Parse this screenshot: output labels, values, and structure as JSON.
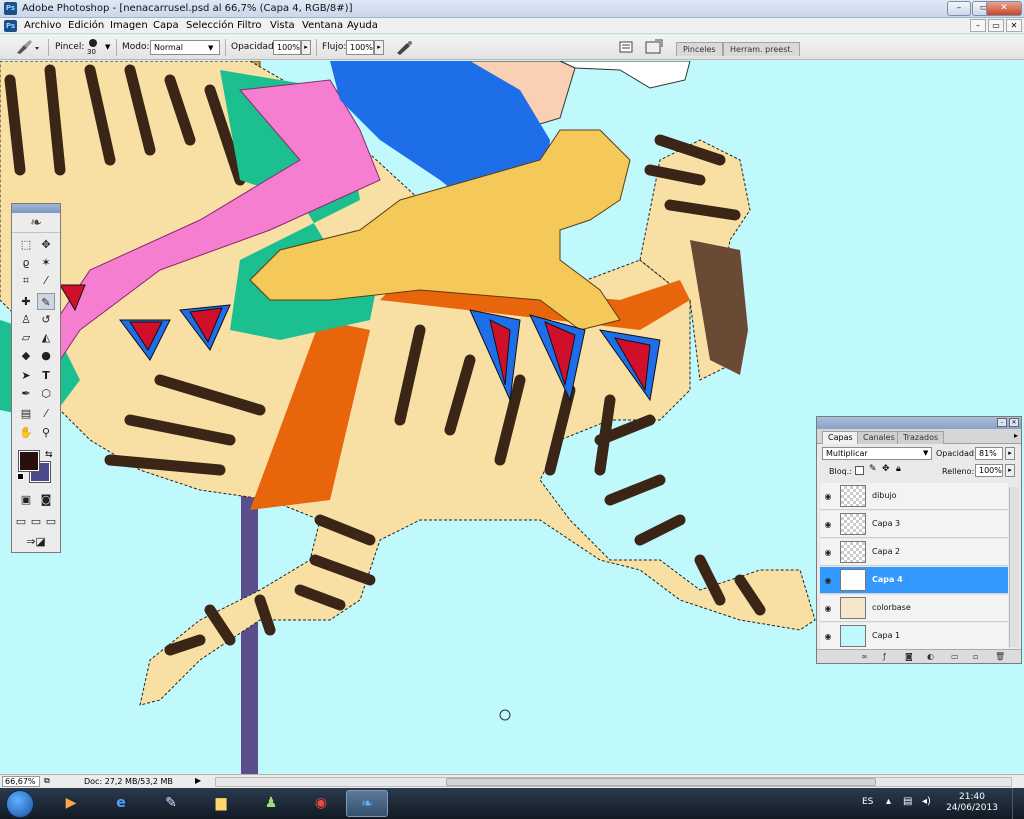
{
  "window": {
    "title": "Adobe Photoshop - [nenacarrusel.psd al 66,7% (Capa 4, RGB/8#)]",
    "buttons": [
      "–",
      "▭",
      "✕"
    ],
    "app_icon_text": "Ps"
  },
  "menubar": {
    "items": [
      "Archivo",
      "Edición",
      "Imagen",
      "Capa",
      "Selección",
      "Filtro",
      "Vista",
      "Ventana",
      "Ayuda"
    ],
    "doc_buttons": [
      "–",
      "▭",
      "✕"
    ]
  },
  "options": {
    "brush_label": "Pincel:",
    "brush_size": "30",
    "mode_label": "Modo:",
    "mode_value": "Normal",
    "opacity_label": "Opacidad:",
    "opacity_value": "100%",
    "flow_label": "Flujo:",
    "flow_value": "100%",
    "palette_tabs": [
      "Pinceles",
      "Herram. preest."
    ]
  },
  "layers_panel": {
    "tabs": [
      "Capas",
      "Canales",
      "Trazados"
    ],
    "blend_mode": "Multiplicar",
    "opacity_label": "Opacidad:",
    "opacity_value": "81%",
    "lock_label": "Bloq.:",
    "fill_label": "Relleno:",
    "fill_value": "100%",
    "layers": [
      {
        "name": "dibujo",
        "selected": false
      },
      {
        "name": "Capa 3",
        "selected": false
      },
      {
        "name": "Capa 2",
        "selected": false
      },
      {
        "name": "Capa 4",
        "selected": true
      },
      {
        "name": "colorbase",
        "selected": false
      },
      {
        "name": "Capa 1",
        "selected": false
      }
    ]
  },
  "statusbar": {
    "zoom": "66,67%",
    "doc_info": "Doc: 27,2 MB/53,2 MB"
  },
  "taskbar": {
    "language": "ES",
    "time": "21:40",
    "date": "24/06/2013"
  },
  "colors": {
    "foreground": "#2a0f0f",
    "background": "#4b4b8e",
    "canvas_bg": "#bff9fb",
    "selected_layer": "#3399ff"
  }
}
